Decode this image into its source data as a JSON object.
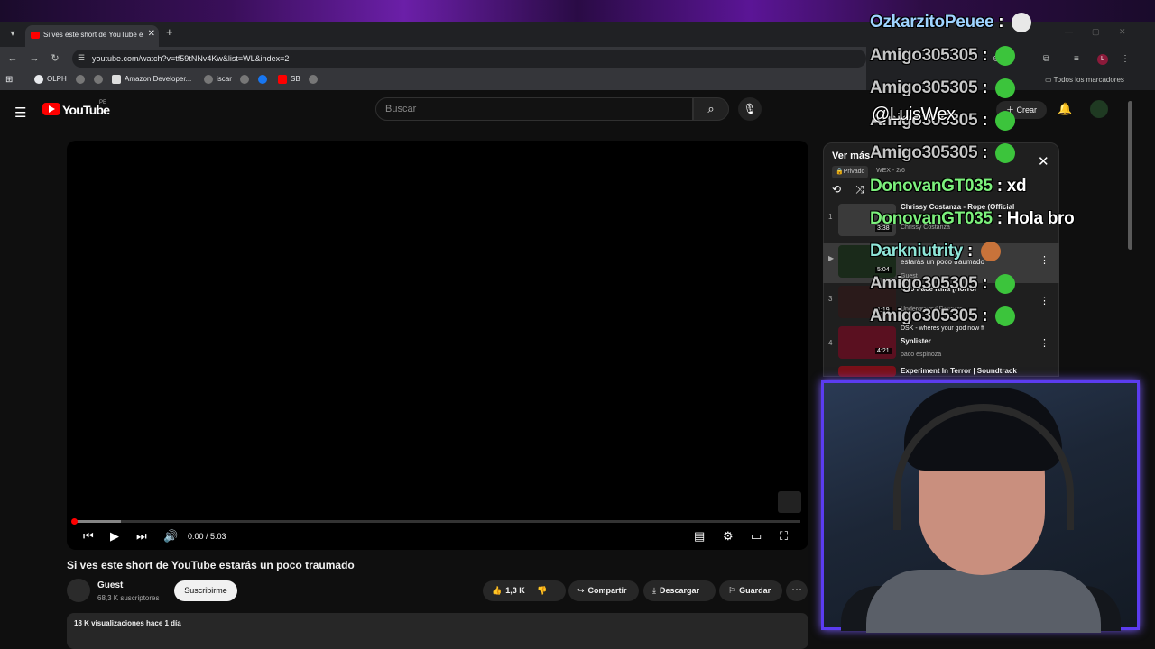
{
  "browser": {
    "tab_title": "Si ves este short de YouTube e",
    "url": "youtube.com/watch?v=tf59tNNv4Kw&list=WL&index=2",
    "bookmarks": [
      "OLPH",
      "Amazon Developer...",
      "iscar",
      "SB"
    ],
    "all_bookmarks": "Todos los marcadores"
  },
  "youtube": {
    "logo": "YouTube",
    "region": "PE",
    "search_placeholder": "Buscar",
    "create_label": "Crear"
  },
  "player": {
    "time": "0:00 / 5:03",
    "progress_fraction": 0.0
  },
  "video": {
    "title": "Si ves este short de YouTube estarás un poco traumado",
    "channel": "Guest",
    "subscribers": "68,3 K suscriptores",
    "subscribe_label": "Suscribirme",
    "likes": "1,3 K",
    "share_label": "Compartir",
    "download_label": "Descargar",
    "save_label": "Guardar",
    "views_meta": "18 K visualizaciones  hace 1 día"
  },
  "playlist": {
    "title": "Ver más",
    "privacy": "Privado",
    "author": "WEX - 2/6",
    "items": [
      {
        "index": "1",
        "title": "Chrissy Costanza - Rope (Official",
        "channel": "Chrissy Costanza",
        "duration": "3:38",
        "color": "#3a3a3a"
      },
      {
        "index": "▶",
        "title": "estarás un poco traumado",
        "channel": "Guest",
        "duration": "5:04",
        "color": "#1a2a1a"
      },
      {
        "index": "3",
        "title": "- No Face Killa [Horror",
        "channel": "Underground Bangers",
        "duration": "1:19",
        "color": "#2a1a1a"
      },
      {
        "index": "4",
        "title": "Synlister",
        "channel": "paco espinoza",
        "duration": "4:21",
        "color": "#5a1020"
      }
    ],
    "next_title": "Experiment In Terror | Soundtrack",
    "item_prefix_4": "DSK - wheres your god now ft"
  },
  "chat": [
    {
      "user": "OzkarzitoPeuee",
      "msg": "",
      "user_color": "#9fd3ff",
      "emote": "skull"
    },
    {
      "user": "Amigo305305",
      "msg": "",
      "user_color": "#c6c6c6",
      "emote": "pepe"
    },
    {
      "user": "Amigo305305",
      "msg": "",
      "user_color": "#c6c6c6",
      "emote": "pepe"
    },
    {
      "user": "Amigo305305",
      "msg": "",
      "user_color": "#c6c6c6",
      "emote": "pepe"
    },
    {
      "user": "Amigo305305",
      "msg": "",
      "user_color": "#c6c6c6",
      "emote": "pepe"
    },
    {
      "user": "DonovanGT035",
      "msg": "xd",
      "user_color": "#7cf07c",
      "emote": ""
    },
    {
      "user": "DonovanGT035",
      "msg": "Hola bro",
      "user_color": "#7cf07c",
      "emote": ""
    },
    {
      "user": "Darkniutrity",
      "msg": "",
      "user_color": "#8fe6d8",
      "emote": "face"
    },
    {
      "user": "Amigo305305",
      "msg": "",
      "user_color": "#c6c6c6",
      "emote": "pepe"
    },
    {
      "user": "Amigo305305",
      "msg": "",
      "user_color": "#c6c6c6",
      "emote": "pepe"
    }
  ],
  "stream": {
    "watermark": "@LuisWex"
  }
}
